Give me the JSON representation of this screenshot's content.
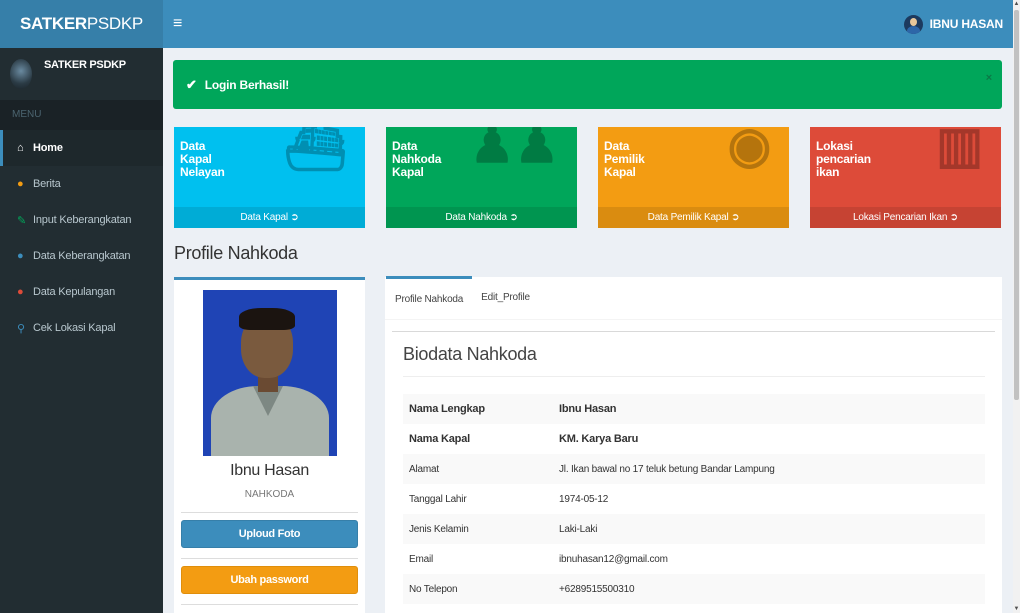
{
  "header": {
    "logo_bold": "SATKER",
    "logo_thin": "PSDKP",
    "toggle_icon": "≡",
    "user_name": "IBNU HASAN"
  },
  "sidebar": {
    "panel_name": "SATKER PSDKP",
    "menu_header": "MENU",
    "items": [
      {
        "label": "Home",
        "icon": "home-icon",
        "glyph": "⌂",
        "color": "#ffffff"
      },
      {
        "label": "Berita",
        "icon": "info-icon",
        "glyph": "●",
        "color": "#f39c12"
      },
      {
        "label": "Input Keberangkatan",
        "icon": "edit-icon",
        "glyph": "✎",
        "color": "#00a65a"
      },
      {
        "label": "Data Keberangkatan",
        "icon": "user-icon",
        "glyph": "●",
        "color": "#3c8dbc"
      },
      {
        "label": "Data Kepulangan",
        "icon": "user-icon",
        "glyph": "●",
        "color": "#dd4b39"
      },
      {
        "label": "Cek Lokasi Kapal",
        "icon": "map-marker-icon",
        "glyph": "⚲",
        "color": "#3c8dbc"
      }
    ]
  },
  "alert": {
    "check_icon": "✔",
    "message": "Login Berhasil!",
    "close": "×"
  },
  "boxes": [
    {
      "line1": "Data",
      "line2": "Kapal",
      "line3": "Nelayan",
      "footer": "Data Kapal ➲",
      "icon": "ship-icon",
      "glyph": "⛴",
      "color": "#00c0ef"
    },
    {
      "line1": "Data",
      "line2": "Nahkoda",
      "line3": "Kapal",
      "footer": "Data Nahkoda ➲",
      "icon": "users-icon",
      "glyph": "♟♟",
      "color": "#00a65a"
    },
    {
      "line1": "Data",
      "line2": "Pemilik",
      "line3": "Kapal",
      "footer": "Data Pemilik Kapal ➲",
      "icon": "user-circle-icon",
      "glyph": "◉",
      "color": "#f39c12"
    },
    {
      "line1": "Lokasi",
      "line2": "pencarian",
      "line3": "ikan",
      "footer": "Lokasi Pencarian Ikan ➲",
      "icon": "map-icon",
      "glyph": "▥",
      "color": "#dd4b39"
    }
  ],
  "page_title": "Profile Nahkoda",
  "profile": {
    "name": "Ibnu Hasan",
    "role": "NAHKODA",
    "upload_button": "Uploud Foto",
    "password_button": "Ubah password"
  },
  "tabs": [
    {
      "label": "Profile Nahkoda",
      "active": true
    },
    {
      "label": "Edit_Profile",
      "active": false
    }
  ],
  "biodata": {
    "title": "Biodata Nahkoda",
    "rows": [
      {
        "label": "Nama Lengkap",
        "value": "Ibnu Hasan"
      },
      {
        "label": "Nama Kapal",
        "value": "KM. Karya Baru"
      },
      {
        "label": "Alamat",
        "value": "Jl. Ikan bawal no 17 teluk betung Bandar Lampung"
      },
      {
        "label": "Tanggal Lahir",
        "value": "1974-05-12"
      },
      {
        "label": "Jenis Kelamin",
        "value": "Laki-Laki"
      },
      {
        "label": "Email",
        "value": "ibnuhasan12@gmail.com"
      },
      {
        "label": "No Telepon",
        "value": "+6289515500310"
      }
    ]
  }
}
